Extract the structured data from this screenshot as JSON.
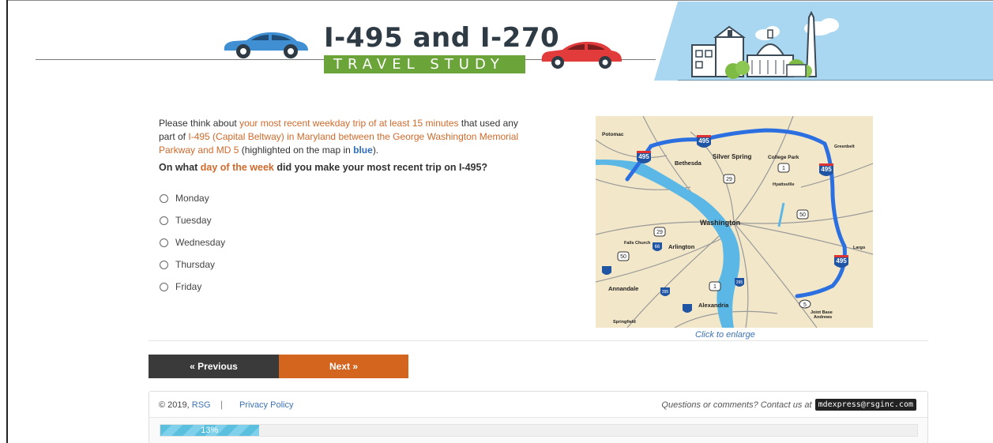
{
  "header": {
    "title": "I-495 and I-270",
    "subtitle": "TRAVEL STUDY"
  },
  "intro": {
    "p1": "Please think about ",
    "h1": "your most recent weekday trip of at least 15 minutes",
    "p2": " that used any part of ",
    "h2": "I-495 (Capital Beltway) in Maryland between the George Washington Memorial Parkway and MD 5",
    "p3": " (highlighted on the map in ",
    "h3": "blue",
    "p4": ")."
  },
  "question": {
    "p1": "On what ",
    "h1": "day of the week",
    "p2": " did you make your most recent trip on I-495?"
  },
  "options": [
    "Monday",
    "Tuesday",
    "Wednesday",
    "Thursday",
    "Friday"
  ],
  "map": {
    "caption": "Click to enlarge",
    "labels": {
      "potomac": "Potomac",
      "bethesda": "Bethesda",
      "silver_spring": "Silver Spring",
      "college_park": "College Park",
      "greenbelt": "Greenbelt",
      "hyattsville": "Hyattsville",
      "washington": "Washington",
      "falls_church": "Falls Church",
      "arlington": "Arlington",
      "largo": "Largo",
      "annandale": "Annandale",
      "alexandria": "Alexandria",
      "springfield": "Springfield",
      "joint_base": "Joint Base",
      "andrews": "Andrews"
    },
    "shields": {
      "i495": "495",
      "us29": "29",
      "us1": "1",
      "us50": "50",
      "i66": "66",
      "i395": "395",
      "i295": "295",
      "md5": "5"
    }
  },
  "nav": {
    "prev": "« Previous",
    "next": "Next »"
  },
  "footer": {
    "copyright": "© 2019, ",
    "org": "RSG",
    "separator": "|",
    "privacy": "Privacy Policy",
    "contact": "Questions or comments? Contact us at",
    "email": "mdexpress@rsginc.com"
  },
  "progress": {
    "percent": 13,
    "label": "13%"
  },
  "colors": {
    "accent_orange": "#d3651f",
    "link_blue": "#3d72b4",
    "title_green": "#6ba53a",
    "route_blue": "#2b6fe0"
  }
}
